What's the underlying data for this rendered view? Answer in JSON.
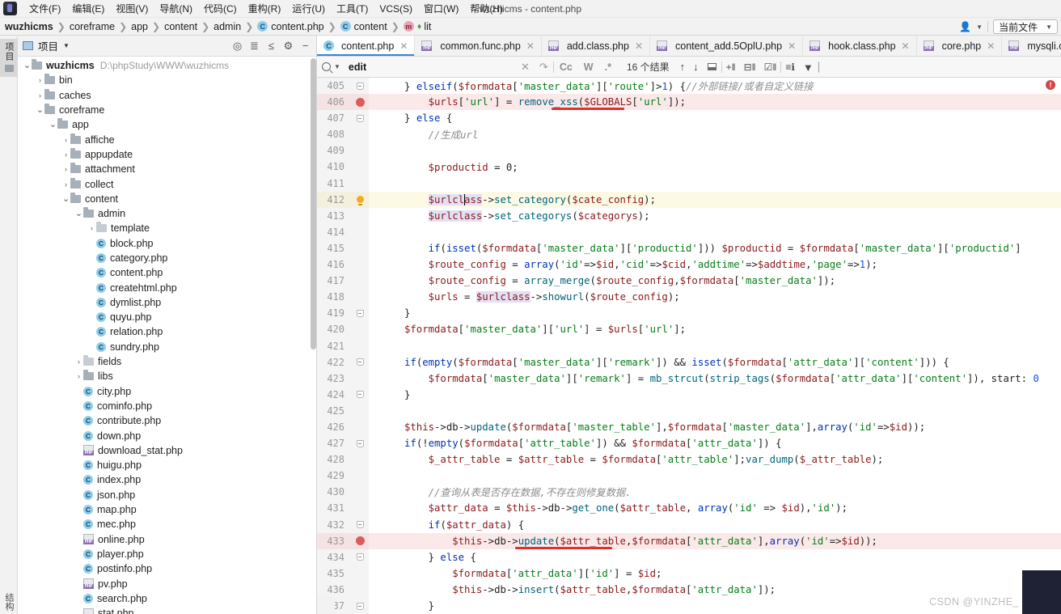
{
  "window": {
    "title": "wuzhicms - content.php"
  },
  "menubar": {
    "items": [
      {
        "label": "文件(F)"
      },
      {
        "label": "编辑(E)"
      },
      {
        "label": "视图(V)"
      },
      {
        "label": "导航(N)"
      },
      {
        "label": "代码(C)"
      },
      {
        "label": "重构(R)"
      },
      {
        "label": "运行(U)"
      },
      {
        "label": "工具(T)"
      },
      {
        "label": "VCS(S)"
      },
      {
        "label": "窗口(W)"
      },
      {
        "label": "帮助(H)"
      }
    ]
  },
  "breadcrumb": {
    "items": [
      {
        "label": "wuzhicms",
        "icon": null,
        "bold": true
      },
      {
        "label": "coreframe",
        "icon": null,
        "bold": false
      },
      {
        "label": "app",
        "icon": null,
        "bold": false
      },
      {
        "label": "content",
        "icon": null,
        "bold": false
      },
      {
        "label": "admin",
        "icon": null,
        "bold": false
      },
      {
        "label": "content.php",
        "icon": "c",
        "bold": false
      },
      {
        "label": "content",
        "icon": "c",
        "bold": false
      },
      {
        "label": "lit",
        "icon": "m",
        "bold": false
      }
    ],
    "scope_label": "当前文件"
  },
  "left_strip": {
    "tab_label": "项目",
    "bottom_label": "结构"
  },
  "project_panel": {
    "title": "项目",
    "root": {
      "name": "wuzhicms",
      "path": "D:\\phpStudy\\WWW\\wuzhicms"
    },
    "tree": [
      {
        "label": "wuzhicms",
        "path": "D:\\phpStudy\\WWW\\wuzhicms",
        "indent": 0,
        "arrow": "down",
        "icon": "folder",
        "bold": true
      },
      {
        "label": "bin",
        "indent": 1,
        "arrow": "right",
        "icon": "folder"
      },
      {
        "label": "caches",
        "indent": 1,
        "arrow": "right",
        "icon": "folder"
      },
      {
        "label": "coreframe",
        "indent": 1,
        "arrow": "down",
        "icon": "folder"
      },
      {
        "label": "app",
        "indent": 2,
        "arrow": "down",
        "icon": "folder"
      },
      {
        "label": "affiche",
        "indent": 3,
        "arrow": "right",
        "icon": "folder"
      },
      {
        "label": "appupdate",
        "indent": 3,
        "arrow": "right",
        "icon": "folder"
      },
      {
        "label": "attachment",
        "indent": 3,
        "arrow": "right",
        "icon": "folder"
      },
      {
        "label": "collect",
        "indent": 3,
        "arrow": "right",
        "icon": "folder"
      },
      {
        "label": "content",
        "indent": 3,
        "arrow": "down",
        "icon": "folder"
      },
      {
        "label": "admin",
        "indent": 4,
        "arrow": "down",
        "icon": "folder"
      },
      {
        "label": "template",
        "indent": 5,
        "arrow": "right",
        "icon": "folder-light"
      },
      {
        "label": "block.php",
        "indent": 5,
        "arrow": "none",
        "icon": "class"
      },
      {
        "label": "category.php",
        "indent": 5,
        "arrow": "none",
        "icon": "class"
      },
      {
        "label": "content.php",
        "indent": 5,
        "arrow": "none",
        "icon": "class"
      },
      {
        "label": "createhtml.php",
        "indent": 5,
        "arrow": "none",
        "icon": "class"
      },
      {
        "label": "dymlist.php",
        "indent": 5,
        "arrow": "none",
        "icon": "class"
      },
      {
        "label": "quyu.php",
        "indent": 5,
        "arrow": "none",
        "icon": "class"
      },
      {
        "label": "relation.php",
        "indent": 5,
        "arrow": "none",
        "icon": "class"
      },
      {
        "label": "sundry.php",
        "indent": 5,
        "arrow": "none",
        "icon": "class"
      },
      {
        "label": "fields",
        "indent": 4,
        "arrow": "right",
        "icon": "folder-light"
      },
      {
        "label": "libs",
        "indent": 4,
        "arrow": "right",
        "icon": "folder"
      },
      {
        "label": "city.php",
        "indent": 4,
        "arrow": "none",
        "icon": "class"
      },
      {
        "label": "cominfo.php",
        "indent": 4,
        "arrow": "none",
        "icon": "class"
      },
      {
        "label": "contribute.php",
        "indent": 4,
        "arrow": "none",
        "icon": "class"
      },
      {
        "label": "down.php",
        "indent": 4,
        "arrow": "none",
        "icon": "class"
      },
      {
        "label": "download_stat.php",
        "indent": 4,
        "arrow": "none",
        "icon": "php"
      },
      {
        "label": "huigu.php",
        "indent": 4,
        "arrow": "none",
        "icon": "class"
      },
      {
        "label": "index.php",
        "indent": 4,
        "arrow": "none",
        "icon": "class"
      },
      {
        "label": "json.php",
        "indent": 4,
        "arrow": "none",
        "icon": "class"
      },
      {
        "label": "map.php",
        "indent": 4,
        "arrow": "none",
        "icon": "class"
      },
      {
        "label": "mec.php",
        "indent": 4,
        "arrow": "none",
        "icon": "class"
      },
      {
        "label": "online.php",
        "indent": 4,
        "arrow": "none",
        "icon": "php"
      },
      {
        "label": "player.php",
        "indent": 4,
        "arrow": "none",
        "icon": "class"
      },
      {
        "label": "postinfo.php",
        "indent": 4,
        "arrow": "none",
        "icon": "class"
      },
      {
        "label": "pv.php",
        "indent": 4,
        "arrow": "none",
        "icon": "php"
      },
      {
        "label": "search.php",
        "indent": 4,
        "arrow": "none",
        "icon": "class"
      },
      {
        "label": "stat.php",
        "indent": 4,
        "arrow": "none",
        "icon": "php"
      }
    ]
  },
  "editor_tabs": [
    {
      "label": "content.php",
      "icon": "class",
      "active": true
    },
    {
      "label": "common.func.php",
      "icon": "php",
      "active": false
    },
    {
      "label": "add.class.php",
      "icon": "php",
      "active": false
    },
    {
      "label": "content_add.5OplU.php",
      "icon": "php",
      "active": false
    },
    {
      "label": "hook.class.php",
      "icon": "php",
      "active": false
    },
    {
      "label": "core.php",
      "icon": "php",
      "active": false
    },
    {
      "label": "mysqli.class.php",
      "icon": "php",
      "active": false
    }
  ],
  "findbar": {
    "query": "edit",
    "placeholder": "edit",
    "match_case_label": "Cc",
    "words_label": "W",
    "regex_label": ".*",
    "results_count": "16 个结果"
  },
  "code": {
    "lines": [
      {
        "num": "405",
        "mark": "fold",
        "hl": "none"
      },
      {
        "num": "406",
        "mark": "breakpoint",
        "hl": "red"
      },
      {
        "num": "407",
        "mark": "fold",
        "hl": "none"
      },
      {
        "num": "408",
        "mark": "none",
        "hl": "none"
      },
      {
        "num": "409",
        "mark": "none",
        "hl": "none"
      },
      {
        "num": "410",
        "mark": "none",
        "hl": "none"
      },
      {
        "num": "411",
        "mark": "none",
        "hl": "none"
      },
      {
        "num": "412",
        "mark": "bulb",
        "hl": "yellow"
      },
      {
        "num": "413",
        "mark": "none",
        "hl": "none"
      },
      {
        "num": "414",
        "mark": "none",
        "hl": "none"
      },
      {
        "num": "415",
        "mark": "none",
        "hl": "none"
      },
      {
        "num": "416",
        "mark": "none",
        "hl": "none"
      },
      {
        "num": "417",
        "mark": "none",
        "hl": "none"
      },
      {
        "num": "418",
        "mark": "none",
        "hl": "none"
      },
      {
        "num": "419",
        "mark": "fold",
        "hl": "none"
      },
      {
        "num": "420",
        "mark": "none",
        "hl": "none"
      },
      {
        "num": "421",
        "mark": "none",
        "hl": "none"
      },
      {
        "num": "422",
        "mark": "fold",
        "hl": "none"
      },
      {
        "num": "423",
        "mark": "none",
        "hl": "none"
      },
      {
        "num": "424",
        "mark": "fold",
        "hl": "none"
      },
      {
        "num": "425",
        "mark": "none",
        "hl": "none"
      },
      {
        "num": "426",
        "mark": "none",
        "hl": "none"
      },
      {
        "num": "427",
        "mark": "fold",
        "hl": "none"
      },
      {
        "num": "428",
        "mark": "none",
        "hl": "none"
      },
      {
        "num": "429",
        "mark": "none",
        "hl": "none"
      },
      {
        "num": "430",
        "mark": "none",
        "hl": "none"
      },
      {
        "num": "431",
        "mark": "none",
        "hl": "none"
      },
      {
        "num": "432",
        "mark": "fold",
        "hl": "none"
      },
      {
        "num": "433",
        "mark": "breakpoint",
        "hl": "red"
      },
      {
        "num": "434",
        "mark": "fold",
        "hl": "none"
      },
      {
        "num": "435",
        "mark": "none",
        "hl": "none"
      },
      {
        "num": "436",
        "mark": "none",
        "hl": "none"
      },
      {
        "num": "437",
        "mark": "fold",
        "hl": "none"
      }
    ],
    "text": [
      "} elseif($formdata['master_data']['route']>1) {//外部链接/或者自定义链接",
      "    $urls['url'] = remove_xss($GLOBALS['url']);",
      "} else {",
      "    //生成url",
      "",
      "    $productid = 0;",
      "",
      "    $urlclass->set_category($cate_config);",
      "    $urlclass->set_categorys($categorys);",
      "",
      "    if(isset($formdata['master_data']['productid'])) $productid = $formdata['master_data']['productid']",
      "    $route_config = array('id'=>$id,'cid'=>$cid,'addtime'=>$addtime,'page'=>1);",
      "    $route_config = array_merge($route_config,$formdata['master_data']);",
      "    $urls = $urlclass->showurl($route_config);",
      "}",
      "$formdata['master_data']['url'] = $urls['url'];",
      "",
      "if(empty($formdata['master_data']['remark']) && isset($formdata['attr_data']['content'])) {",
      "    $formdata['master_data']['remark'] = mb_strcut(strip_tags($formdata['attr_data']['content']), start: 0",
      "}",
      "",
      "$this->db->update($formdata['master_table'],$formdata['master_data'],array('id'=>$id));",
      "if(!empty($formdata['attr_table']) && $formdata['attr_data']) {",
      "    $_attr_table = $attr_table = $formdata['attr_table'];var_dump($_attr_table);",
      "",
      "    //查询从表是否存在数据,不存在则修复数据.",
      "    $attr_data = $this->db->get_one($attr_table, array('id' => $id),'id');",
      "    if($attr_data) {",
      "        $this->db->update($attr_table,$formdata['attr_data'],array('id'=>$id));",
      "    } else {",
      "        $formdata['attr_data']['id'] = $id;",
      "        $this->db->insert($attr_table,$formdata['attr_data']);",
      "    }"
    ],
    "hint_label": "start:",
    "annotations": [
      {
        "name": "remove-xss-underline",
        "line": 406
      },
      {
        "name": "update-underline",
        "line": 433
      }
    ],
    "error_badge": "!"
  },
  "watermark": {
    "text": "CSDN @YINZHE_"
  },
  "colors": {
    "accent": "#3b85d0",
    "breakpoint": "#db5c5c",
    "annotation": "#e03131",
    "highlight_red": "#fbe9e9",
    "highlight_yellow": "#fcfae4"
  }
}
